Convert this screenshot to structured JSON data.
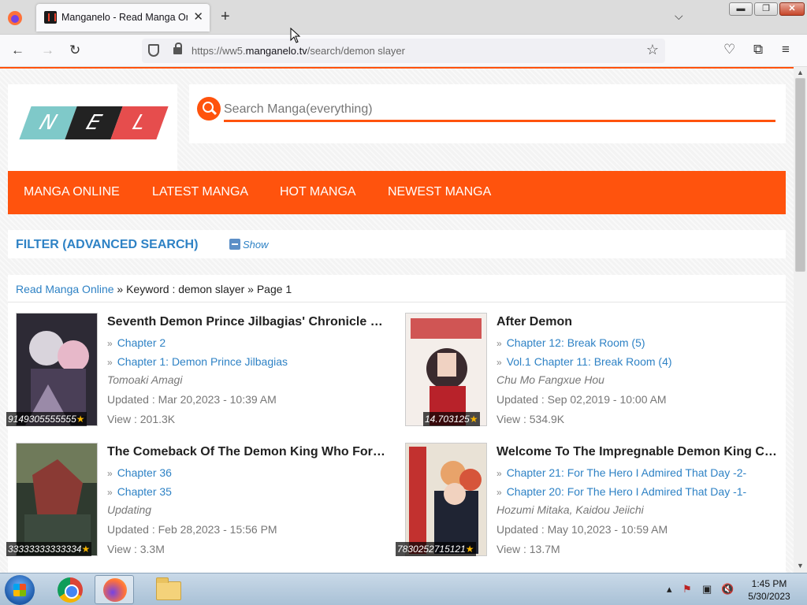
{
  "browser": {
    "tab_title": "Manganelo - Read Manga Online",
    "url_prefix": "https://ww5.",
    "url_domain": "manganelo.tv",
    "url_path": "/search/demon slayer"
  },
  "site": {
    "logo": [
      "N",
      "E",
      "L"
    ],
    "search_placeholder": "Search Manga(everything)",
    "menu": [
      "MANGA ONLINE",
      "LATEST MANGA",
      "HOT MANGA",
      "NEWEST MANGA"
    ],
    "filter_title": "FILTER (ADVANCED SEARCH)",
    "filter_toggle": "Show",
    "breadcrumb_link": "Read Manga Online",
    "breadcrumb_rest": " » Keyword : demon slayer » Page 1"
  },
  "results": [
    {
      "title": "Seventh Demon Prince Jilbagias' Chronicle of Conquest",
      "ch1": "Chapter 2",
      "ch2": "Chapter 1: Demon Prince Jilbagias",
      "author": "Tomoaki Amagi",
      "updated": "Updated : Mar 20,2023 - 10:39 AM",
      "view": "View : 201.3K",
      "rating": "9149305555555"
    },
    {
      "title": "After Demon",
      "ch1": "Chapter 12: Break Room (5)",
      "ch2": "Vol.1 Chapter 11: Break Room (4)",
      "author": "Chu Mo Fangxue Hou",
      "updated": "Updated : Sep 02,2019 - 10:00 AM",
      "view": "View : 534.9K",
      "rating": "14.703125"
    },
    {
      "title": "The Comeback Of The Demon King Who Formed A Demon's Guild After Being Vanquished By The Hero",
      "ch1": "Chapter 36",
      "ch2": "Chapter 35",
      "author": "Updating",
      "updated": "Updated : Feb 28,2023 - 15:56 PM",
      "view": "View : 3.3M",
      "rating": "33333333333334"
    },
    {
      "title": "Welcome To The Impregnable Demon King Castle",
      "ch1": "Chapter 21: For The Hero I Admired That Day -2-",
      "ch2": "Chapter 20: For The Hero I Admired That Day -1-",
      "author": "Hozumi Mitaka, Kaidou Jeiichi",
      "updated": "Updated : May 10,2023 - 10:59 AM",
      "view": "View : 13.7M",
      "rating": "7830252715121"
    }
  ],
  "taskbar": {
    "time": "1:45 PM",
    "date": "5/30/2023"
  },
  "colors": {
    "accent": "#ff530d",
    "link": "#2e82c5"
  }
}
